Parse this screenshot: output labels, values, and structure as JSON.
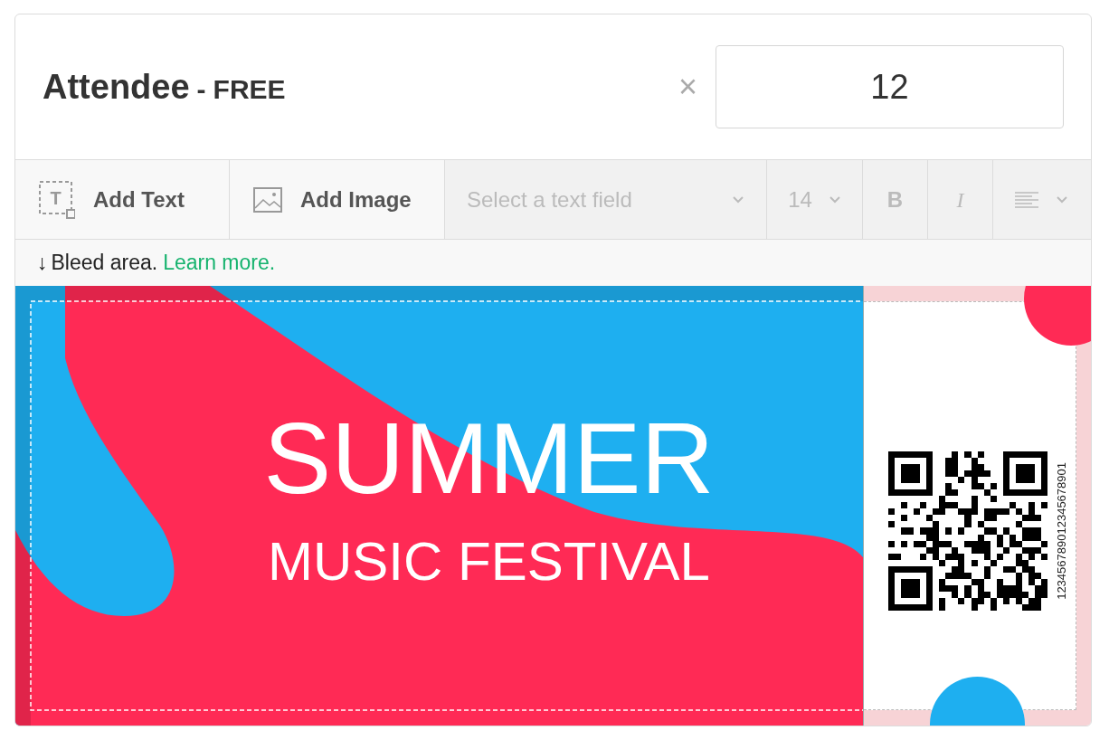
{
  "ticket_type": {
    "name": "Attendee",
    "separator": "-",
    "price": "FREE"
  },
  "remove": "×",
  "quantity": "12",
  "toolbar": {
    "add_text_icon_letter": "T",
    "add_text": "Add Text",
    "add_image": "Add Image",
    "disabled": true,
    "text_field_placeholder": "Select a text field",
    "font_size": "14",
    "bold": "B",
    "italic": "I"
  },
  "bleed_notice": {
    "arrow": "↓",
    "text": "Bleed area.",
    "link": "Learn more."
  },
  "ticket": {
    "title": "SUMMER",
    "subtitle": "MUSIC FESTIVAL",
    "code_number": "123456789012345678901"
  }
}
